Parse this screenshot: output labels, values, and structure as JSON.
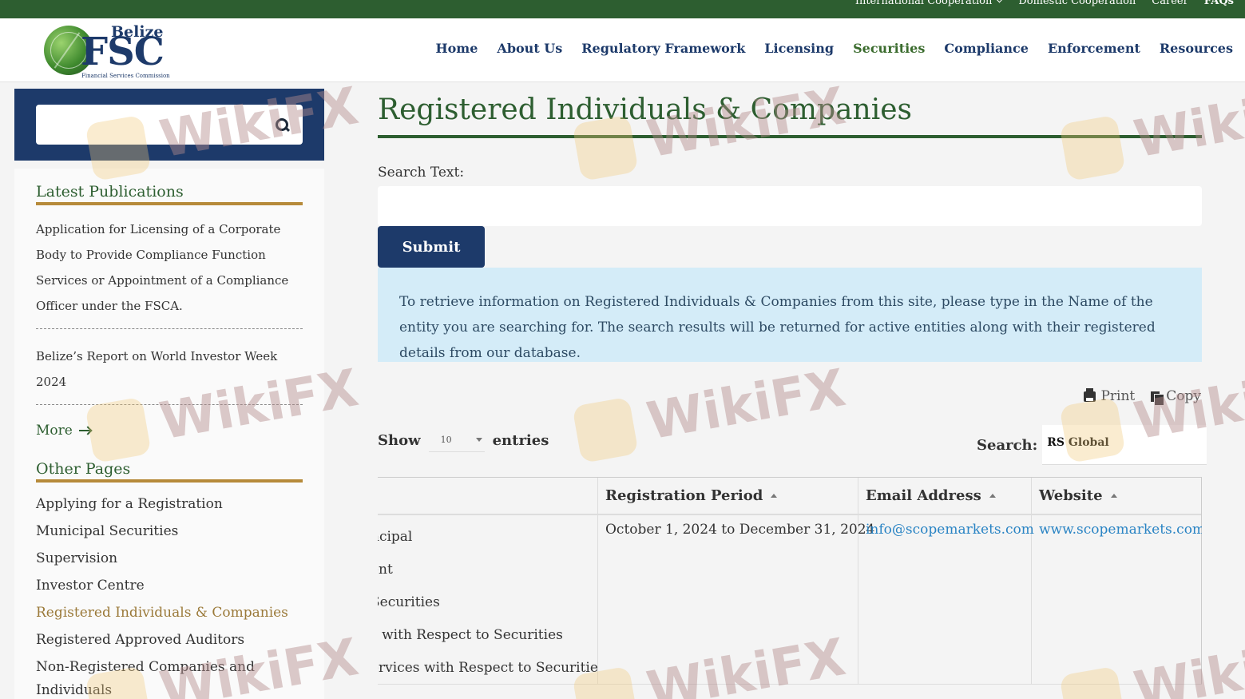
{
  "topbar": {
    "links": [
      "International Cooperation",
      "Domestic Cooperation",
      "Career",
      "FAQs"
    ]
  },
  "logo": {
    "country": "Belize",
    "acronym": "FSC",
    "subtitle": "Financial Services Commission"
  },
  "nav": {
    "items": [
      "Home",
      "About Us",
      "Regulatory Framework",
      "Licensing",
      "Securities",
      "Compliance",
      "Enforcement",
      "Resources"
    ],
    "active": "Securities"
  },
  "sidebar": {
    "search_placeholder": "",
    "latest_title": "Latest Publications",
    "publications": [
      "Application for Licensing of a Corporate Body to Provide Compliance Function Services or Appointment of a Compliance Officer under the FSCA.",
      "Belize’s Report on World Investor Week 2024"
    ],
    "more_label": "More",
    "other_title": "Other Pages",
    "other_pages": [
      "Applying for a Registration",
      "Municipal Securities",
      "Supervision",
      "Investor Centre",
      "Registered Individuals & Companies",
      "Registered Approved Auditors",
      "Non-Registered Companies and Individuals"
    ]
  },
  "main": {
    "title": "Registered Individuals & Companies",
    "search_label": "Search Text:",
    "search_value": "",
    "submit_label": "Submit",
    "info_text": "To retrieve information on Registered Individuals & Companies from this site, please type in the Name of the entity you are searching for. The search results will be returned for active entities along with their registered details from our database.",
    "print_label": "Print",
    "copy_label": "Copy",
    "show_label": "Show",
    "entries_value": "10",
    "entries_label": "entries",
    "table_search_label": "Search:",
    "table_search_value": "RS Global",
    "table": {
      "headers": [
        "Registration Period",
        "Email Address",
        "Website"
      ],
      "first_col_lines": [
        "ncipal",
        "ent",
        "Securities",
        "s with Respect to Securities",
        "ervices with Respect to Securities"
      ],
      "registration_period": "October 1, 2024 to December 31, 2024",
      "email": "info@scopemarkets.com",
      "website": "www.scopemarkets.com"
    }
  },
  "watermark": "WikiFX"
}
